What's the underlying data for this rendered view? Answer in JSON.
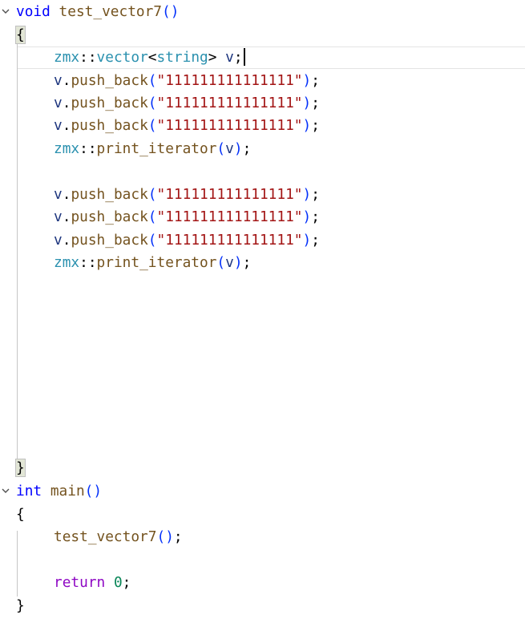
{
  "code": {
    "l1": {
      "kw": "void",
      "fn": "test_vector7",
      "open": "(",
      "close": ")"
    },
    "l2": {
      "brace": "{"
    },
    "l3": {
      "ns": "zmx",
      "sep": "::",
      "type": "vector",
      "lt": "<",
      "targ": "string",
      "gt": ">",
      "var": "v",
      "end": ";"
    },
    "push": {
      "obj": "v",
      "dot": ".",
      "method": "push_back",
      "open": "(",
      "close": ")",
      "end": ";",
      "str": "\"111111111111111\""
    },
    "print": {
      "ns": "zmx",
      "sep": "::",
      "fn": "print_iterator",
      "open": "(",
      "arg": "v",
      "close": ")",
      "end": ";"
    },
    "l15": {
      "brace": "}"
    },
    "main": {
      "kw": "int",
      "fn": "main",
      "open": "(",
      "close": ")"
    },
    "main_open": "{",
    "call": {
      "fn": "test_vector7",
      "open": "(",
      "close": ")",
      "end": ";"
    },
    "ret": {
      "kw": "return",
      "num": "0",
      "end": ";"
    },
    "main_close": "}"
  },
  "icons": {
    "fold_1": "chevron-down-icon",
    "fold_2": "chevron-down-icon"
  }
}
